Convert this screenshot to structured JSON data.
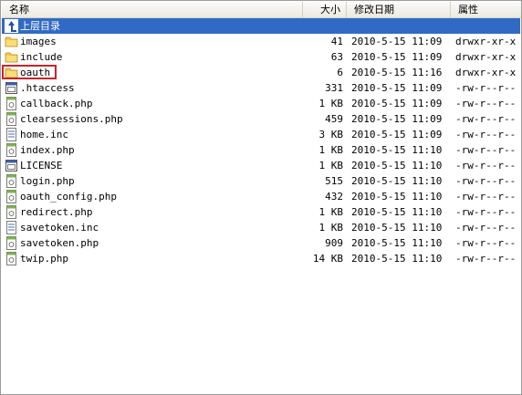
{
  "columns": {
    "name": "名称",
    "size": "大小",
    "date": "修改日期",
    "attr": "属性"
  },
  "parent_label": "上层目录",
  "files": [
    {
      "name": "images",
      "size": "41",
      "date": "2010-5-15 11:09",
      "attr": "drwxr-xr-x",
      "icon": "folder-icon"
    },
    {
      "name": "include",
      "size": "63",
      "date": "2010-5-15 11:09",
      "attr": "drwxr-xr-x",
      "icon": "folder-icon"
    },
    {
      "name": "oauth",
      "size": "6",
      "date": "2010-5-15 11:16",
      "attr": "drwxr-xr-x",
      "icon": "folder-icon"
    },
    {
      "name": ".htaccess",
      "size": "331",
      "date": "2010-5-15 11:09",
      "attr": "-rw-r--r--",
      "icon": "config-file-icon"
    },
    {
      "name": "callback.php",
      "size": "1 KB",
      "date": "2010-5-15 11:09",
      "attr": "-rw-r--r--",
      "icon": "php-file-icon"
    },
    {
      "name": "clearsessions.php",
      "size": "459",
      "date": "2010-5-15 11:09",
      "attr": "-rw-r--r--",
      "icon": "php-file-icon"
    },
    {
      "name": "home.inc",
      "size": "3 KB",
      "date": "2010-5-15 11:09",
      "attr": "-rw-r--r--",
      "icon": "text-file-icon"
    },
    {
      "name": "index.php",
      "size": "1 KB",
      "date": "2010-5-15 11:10",
      "attr": "-rw-r--r--",
      "icon": "php-file-icon"
    },
    {
      "name": "LICENSE",
      "size": "1 KB",
      "date": "2010-5-15 11:10",
      "attr": "-rw-r--r--",
      "icon": "config-file-icon"
    },
    {
      "name": "login.php",
      "size": "515",
      "date": "2010-5-15 11:10",
      "attr": "-rw-r--r--",
      "icon": "php-file-icon"
    },
    {
      "name": "oauth_config.php",
      "size": "432",
      "date": "2010-5-15 11:10",
      "attr": "-rw-r--r--",
      "icon": "php-file-icon"
    },
    {
      "name": "redirect.php",
      "size": "1 KB",
      "date": "2010-5-15 11:10",
      "attr": "-rw-r--r--",
      "icon": "php-file-icon"
    },
    {
      "name": "savetoken.inc",
      "size": "1 KB",
      "date": "2010-5-15 11:10",
      "attr": "-rw-r--r--",
      "icon": "text-file-icon"
    },
    {
      "name": "savetoken.php",
      "size": "909",
      "date": "2010-5-15 11:10",
      "attr": "-rw-r--r--",
      "icon": "php-file-icon"
    },
    {
      "name": "twip.php",
      "size": "14 KB",
      "date": "2010-5-15 11:10",
      "attr": "-rw-r--r--",
      "icon": "php-file-icon"
    }
  ],
  "colors": {
    "selection": "#316ac5",
    "highlight_border": "#c8232a",
    "folder": "#f5c94a"
  }
}
